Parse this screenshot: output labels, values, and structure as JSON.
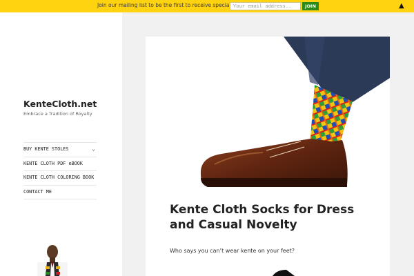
{
  "topbar": {
    "message": "Join our mailing list to be the first to receive special offers!",
    "email_placeholder": "Your email address..",
    "join_label": "JOIN",
    "collapse_icon": "▲"
  },
  "site": {
    "title": "KenteCloth.net",
    "tagline": "Embrace a Tradition of Royalty"
  },
  "nav": {
    "items": [
      {
        "label": "BUY KENTE STOLES",
        "chevron": "⌄"
      },
      {
        "label": "KENTE CLOTH PDF eBOOK"
      },
      {
        "label": "KENTE CLOTH COLORING BOOK"
      },
      {
        "label": "CONTACT ME"
      }
    ]
  },
  "post": {
    "title": "Kente Cloth Socks for Dress and Casual Novelty",
    "excerpt": "Who says you can’t wear kente on your feet?"
  },
  "colors": {
    "topbar_bg": "#ffd30f",
    "join_bg": "#2c8a1a",
    "page_bg": "#f1f1f1"
  }
}
